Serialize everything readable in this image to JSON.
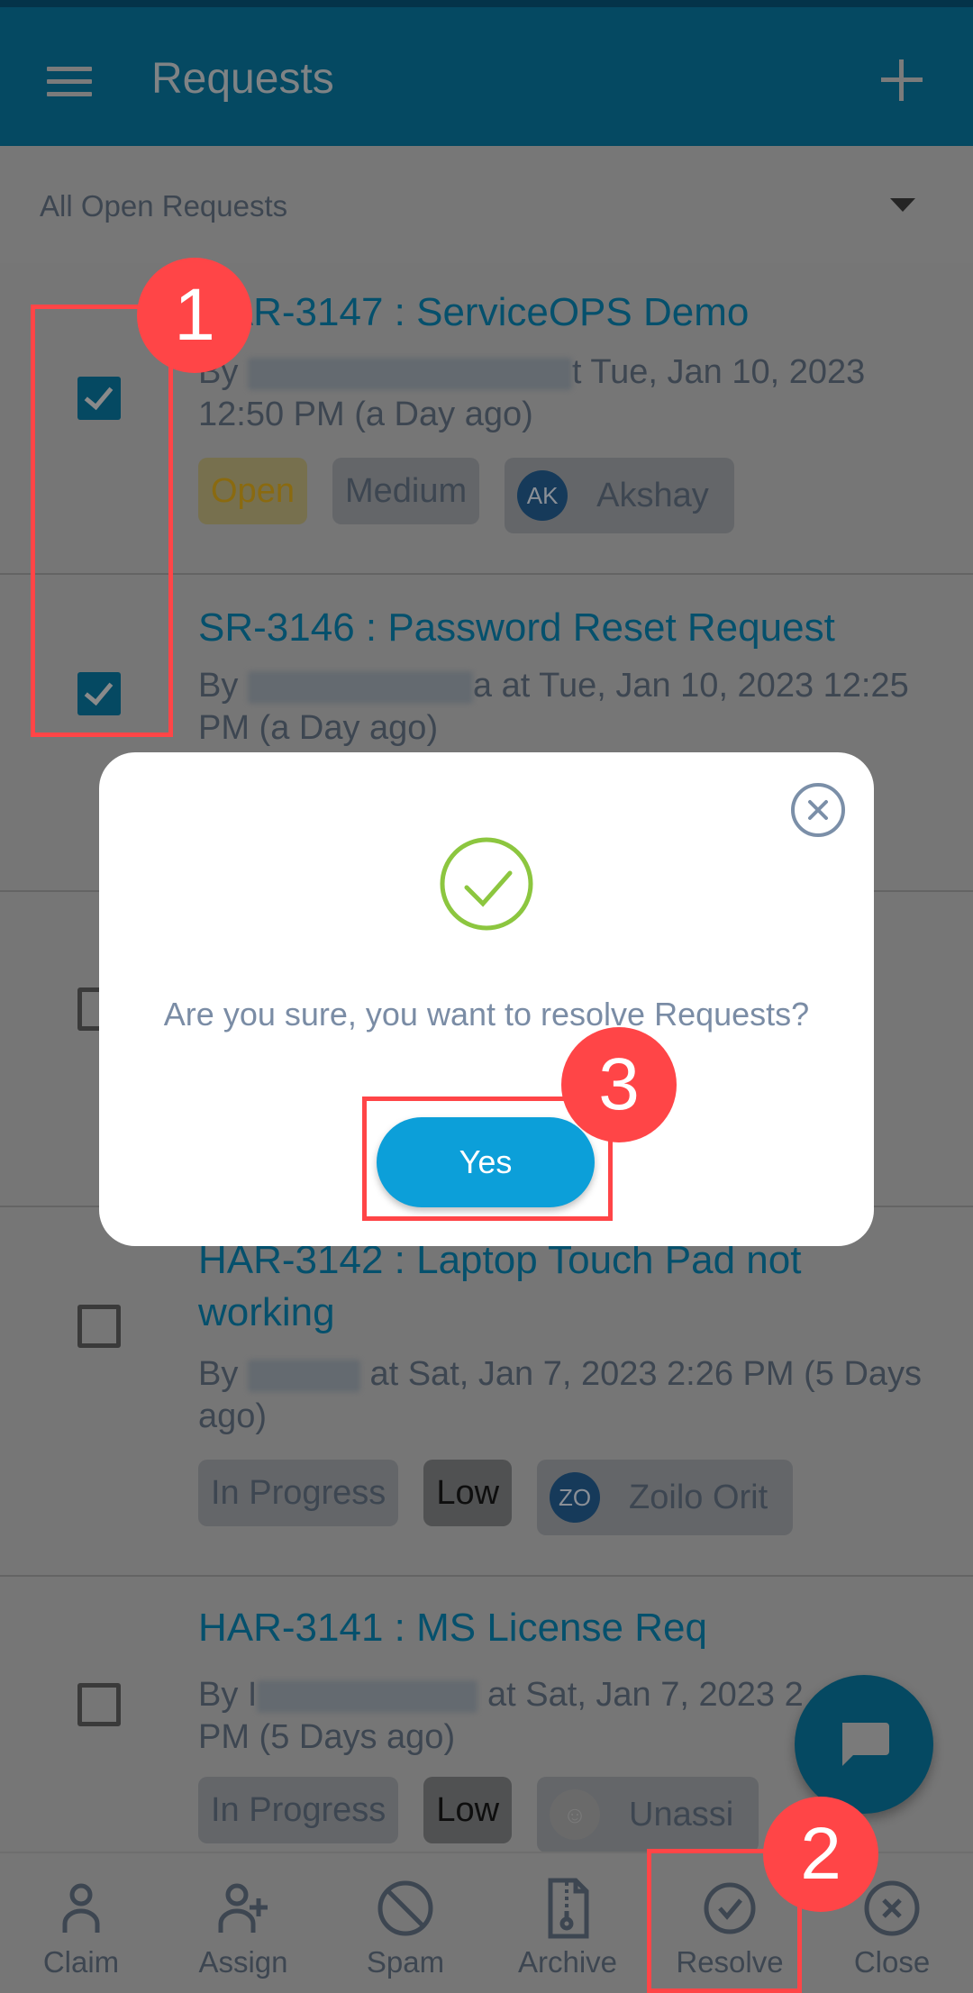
{
  "header": {
    "title": "Requests",
    "menu_icon": "hamburger-menu-icon",
    "add_icon": "plus-icon"
  },
  "filter": {
    "selected": "All Open Requests"
  },
  "requests": [
    {
      "title": "HAR-3147 : ServiceOPS Demo",
      "by_prefix": "By ",
      "meta_suffix": "t Tue, Jan 10, 2023 12:50 PM (a Day ago)",
      "checked": true,
      "status": "Open",
      "priority": "Medium",
      "assignee_initials": "AK",
      "assignee": "Akshay"
    },
    {
      "title": "SR-3146 : Password Reset Request",
      "by_prefix": "By ",
      "meta_suffix": "a at Tue, Jan 10, 2023 12:25 PM (a Day ago)",
      "checked": true
    },
    {
      "checked": false
    },
    {
      "title": "HAR-3142 : Laptop Touch Pad not working",
      "by_prefix": "By ",
      "meta_suffix": " at Sat, Jan 7, 2023 2:26 PM (5 Days ago)",
      "checked": false,
      "status": "In Progress",
      "priority": "Low",
      "assignee_initials": "ZO",
      "assignee": "Zoilo Orit"
    },
    {
      "title": "HAR-3141 : MS License Req",
      "by_prefix": "By I",
      "meta_suffix": " at Sat, Jan 7, 2023 2:... PM (5 Days ago)",
      "meta_line1_suffix": " at Sat, Jan 7, 2023 2",
      "meta_line2": "PM (5 Days ago)",
      "checked": false,
      "status": "In Progress",
      "priority": "Low",
      "assignee": "Unassigned",
      "assignee_visible": "Unassi"
    }
  ],
  "dialog": {
    "message": "Are you sure, you want to resolve Requests?",
    "confirm_label": "Yes",
    "icon": "check-circle-icon",
    "close_icon": "close-circle-icon"
  },
  "bottom_nav": [
    {
      "label": "Claim",
      "icon": "user-icon"
    },
    {
      "label": "Assign",
      "icon": "user-plus-icon"
    },
    {
      "label": "Spam",
      "icon": "block-icon"
    },
    {
      "label": "Archive",
      "icon": "zip-file-icon"
    },
    {
      "label": "Resolve",
      "icon": "check-circle-icon"
    },
    {
      "label": "Close",
      "icon": "close-circle-icon"
    }
  ],
  "annotations": [
    {
      "label": "1"
    },
    {
      "label": "2"
    },
    {
      "label": "3"
    }
  ],
  "colors": {
    "header": "#05506c",
    "accent": "#0c9fd9",
    "annotation": "#ff4547",
    "success": "#8cc63f"
  }
}
